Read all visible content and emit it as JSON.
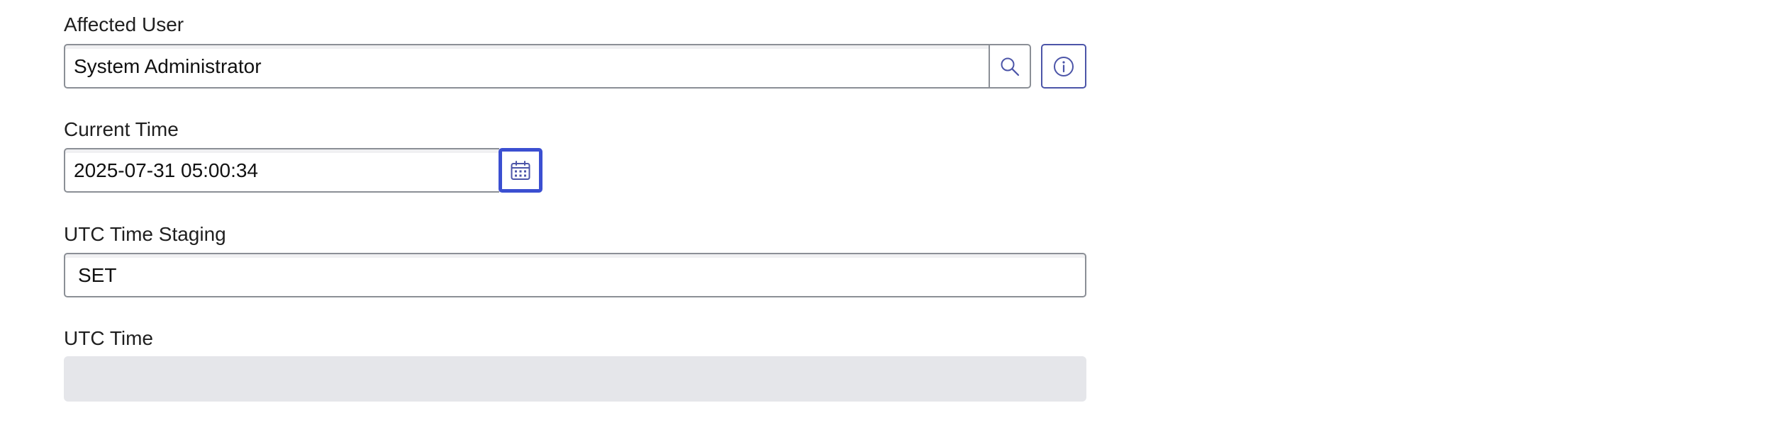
{
  "fields": {
    "affected_user": {
      "label": "Affected User",
      "value": "System Administrator"
    },
    "current_time": {
      "label": "Current Time",
      "value": "2025-07-31 05:00:34"
    },
    "utc_time_staging": {
      "label": "UTC Time Staging",
      "value": "SET"
    },
    "utc_time": {
      "label": "UTC Time",
      "value": ""
    }
  },
  "icons": {
    "search": "search-icon",
    "info": "info-icon",
    "calendar": "calendar-icon"
  },
  "colors": {
    "accent": "#3b4fd1",
    "icon": "#4c55a8",
    "border": "#8b8f96",
    "readonly_bg": "#e5e6ea"
  }
}
